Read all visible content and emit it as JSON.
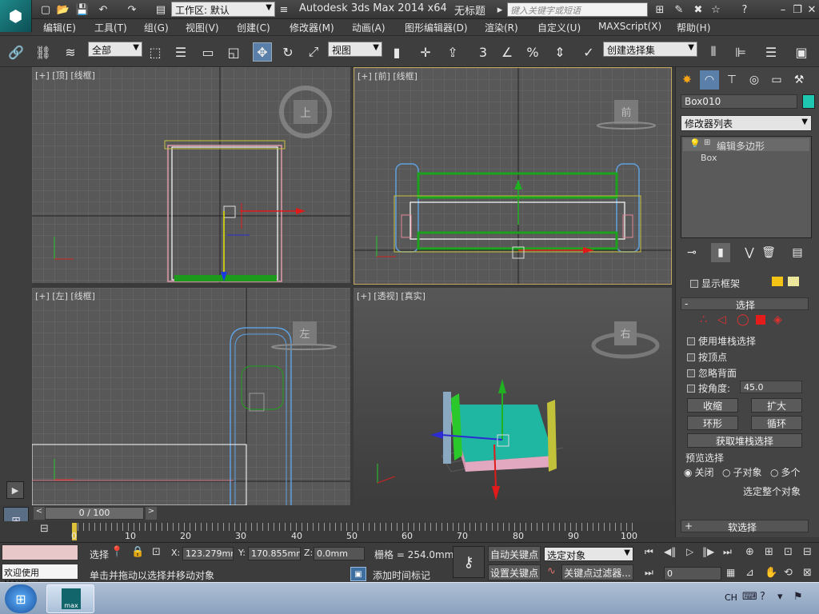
{
  "titlebar": {
    "workspace_label": "工作区: 默认",
    "app_title": "Autodesk 3ds Max  2014 x64",
    "doc_title": "无标题",
    "search_placeholder": "键入关键字或短语"
  },
  "menu": [
    "编辑(E)",
    "工具(T)",
    "组(G)",
    "视图(V)",
    "创建(C)",
    "修改器(M)",
    "动画(A)",
    "图形编辑器(D)",
    "渲染(R)",
    "自定义(U)",
    "MAXScript(X)",
    "帮助(H)"
  ],
  "toolbar": {
    "filter_combo": "全部",
    "ref_coord_combo": "视图",
    "snap_label": "3",
    "selection_set_combo": "创建选择集"
  },
  "viewports": {
    "top_label": "[+] [顶] [线框]",
    "front_label": "[+] [前] [线框]",
    "left_label": "[+] [左] [线框]",
    "persp_label": "[+] [透视] [真实]",
    "top_cube": "上",
    "front_cube": "前",
    "left_cube": "左",
    "persp_cube": "右"
  },
  "command_panel": {
    "object_name": "Box010",
    "object_color": "#1ec8b0",
    "modifier_list": "修改器列表",
    "stack_item_1": "编辑多边形",
    "stack_item_2": "Box",
    "show_cage": "显示框架",
    "selection_rollout": "选择",
    "use_stack": "使用堆栈选择",
    "by_vertex": "按顶点",
    "ignore_backfacing": "忽略背面",
    "by_angle": "按角度:",
    "angle_value": "45.0",
    "shrink": "收缩",
    "grow": "扩大",
    "ring": "环形",
    "loop": "循环",
    "get_stack": "获取堆栈选择",
    "preview_label": "预览选择",
    "preview_off": "关闭",
    "preview_sub": "子对象",
    "preview_multi": "多个",
    "select_whole": "选定整个对象",
    "soft_selection": "软选择"
  },
  "timeline": {
    "frame_counter": "0 / 100",
    "ticks": [
      "0",
      "10",
      "20",
      "30",
      "40",
      "50",
      "60",
      "70",
      "80",
      "90",
      "100"
    ]
  },
  "status": {
    "welcome": "欢迎使用  MAXScri",
    "select_label": "选择",
    "x_label": "X:",
    "x_value": "123.279mm",
    "y_label": "Y:",
    "y_value": "170.855mm",
    "z_label": "Z:",
    "z_value": "0.0mm",
    "grid": "栅格 = 254.0mm",
    "auto_key": "自动关键点",
    "selected_object": "选定对象",
    "set_key": "设置关键点",
    "key_filters": "关键点过滤器...",
    "prompt": "单击并拖动以选择并移动对象",
    "add_time_tag": "添加时间标记",
    "frame_field": "0"
  },
  "taskbar": {
    "app_label": "max",
    "lang": "CH"
  }
}
